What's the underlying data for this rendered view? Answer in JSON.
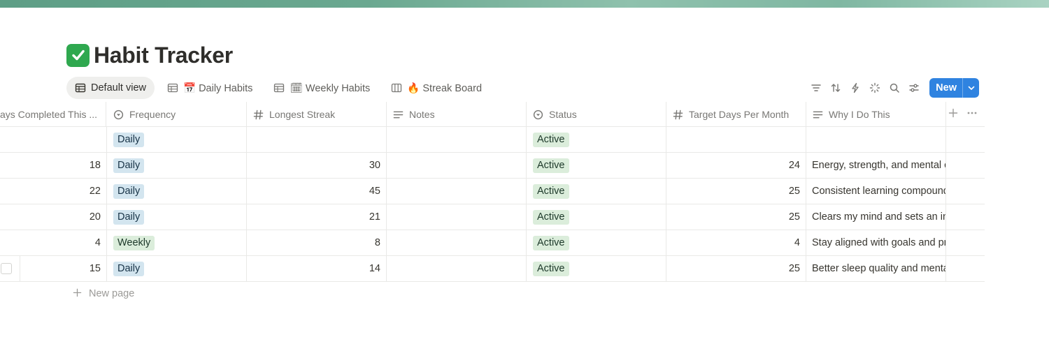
{
  "page": {
    "title": "Habit Tracker",
    "title_icon": "check-mark-emoji"
  },
  "views": [
    {
      "label": "Default view",
      "icon": "table-icon",
      "emoji": ""
    },
    {
      "label": "Daily Habits",
      "icon": "table-icon",
      "emoji": "📅"
    },
    {
      "label": "Weekly Habits",
      "icon": "table-icon",
      "emoji": "🗓"
    },
    {
      "label": "Streak Board",
      "icon": "board-icon",
      "emoji": "🔥"
    }
  ],
  "toolbar": {
    "new_label": "New",
    "icons": [
      "filter-icon",
      "sort-icon",
      "automation-icon",
      "ai-sparkle-icon",
      "search-icon",
      "settings-icon"
    ],
    "accent": "#2f83e0"
  },
  "columns": [
    {
      "label": "ays Completed This ...",
      "icon": ""
    },
    {
      "label": "Frequency",
      "icon": "select-icon"
    },
    {
      "label": "Longest Streak",
      "icon": "number-icon"
    },
    {
      "label": "Notes",
      "icon": "text-icon"
    },
    {
      "label": "Status",
      "icon": "status-icon"
    },
    {
      "label": "Target Days Per Month",
      "icon": "number-icon"
    },
    {
      "label": "Why I Do This",
      "icon": "text-icon"
    }
  ],
  "rows": [
    {
      "days": "",
      "frequency": "Daily",
      "longest": "",
      "notes": "",
      "status": "Active",
      "target": "",
      "why": ""
    },
    {
      "days": "18",
      "frequency": "Daily",
      "longest": "30",
      "notes": "",
      "status": "Active",
      "target": "24",
      "why": "Energy, strength, and mental c"
    },
    {
      "days": "22",
      "frequency": "Daily",
      "longest": "45",
      "notes": "",
      "status": "Active",
      "target": "25",
      "why": "Consistent learning compound"
    },
    {
      "days": "20",
      "frequency": "Daily",
      "longest": "21",
      "notes": "",
      "status": "Active",
      "target": "25",
      "why": "Clears my mind and sets an in"
    },
    {
      "days": "4",
      "frequency": "Weekly",
      "longest": "8",
      "notes": "",
      "status": "Active",
      "target": "4",
      "why": "Stay aligned with goals and pr"
    },
    {
      "days": "15",
      "frequency": "Daily",
      "longest": "14",
      "notes": "",
      "status": "Active",
      "target": "25",
      "why": "Better sleep quality and menta"
    }
  ],
  "footer": {
    "new_page_label": "New page"
  },
  "colors": {
    "daily_pill": "#d3e5ef",
    "weekly_pill": "#dbeddb",
    "active_pill": "#dbeddb",
    "cover": "#6aa890"
  }
}
